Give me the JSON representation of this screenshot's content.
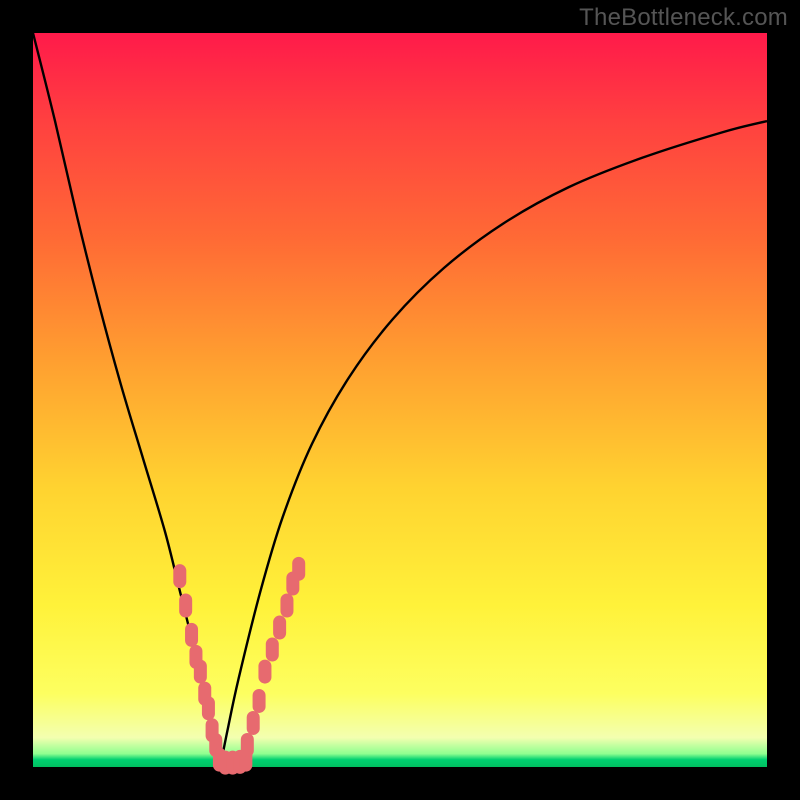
{
  "watermark": "TheBottleneck.com",
  "colors": {
    "page_bg": "#000000",
    "curve": "#000000",
    "marker_fill": "#e76a6f",
    "marker_stroke": "#c94a50",
    "gradient_stops": [
      "#ff1a4a",
      "#ff4040",
      "#ff6a35",
      "#ffa030",
      "#ffd330",
      "#fff23a",
      "#fdff60",
      "#f3ffb0",
      "#8fff90",
      "#00d070",
      "#00c060"
    ]
  },
  "chart_data": {
    "type": "line",
    "title": "",
    "xlabel": "",
    "ylabel": "",
    "xlim": [
      0,
      100
    ],
    "ylim": [
      0,
      100
    ],
    "grid": false,
    "notes": "Two black curves descending into a V; minimum near x≈25, y≈0. Background is a vertical red→yellow→green gradient. Pink rounded markers overlay the lower portion of both curves and along the trough.",
    "series": [
      {
        "name": "left-curve",
        "x": [
          0,
          3,
          6,
          9,
          12,
          15,
          18,
          20,
          22,
          23.5,
          24.5,
          25.5
        ],
        "values": [
          100,
          88,
          75,
          63,
          52,
          42,
          32,
          24,
          16,
          10,
          4,
          0
        ]
      },
      {
        "name": "right-curve",
        "x": [
          25.5,
          26.5,
          28,
          31,
          34,
          38,
          43,
          49,
          56,
          64,
          73,
          83,
          94,
          100
        ],
        "values": [
          0,
          5,
          12,
          24,
          34,
          44,
          53,
          61,
          68,
          74,
          79,
          83,
          86.5,
          88
        ]
      }
    ],
    "markers": {
      "name": "pink-markers",
      "shape": "rounded",
      "points": [
        {
          "x": 20.0,
          "y": 26
        },
        {
          "x": 20.8,
          "y": 22
        },
        {
          "x": 21.6,
          "y": 18
        },
        {
          "x": 22.2,
          "y": 15
        },
        {
          "x": 22.8,
          "y": 13
        },
        {
          "x": 23.4,
          "y": 10
        },
        {
          "x": 23.9,
          "y": 8
        },
        {
          "x": 24.4,
          "y": 5
        },
        {
          "x": 24.9,
          "y": 3
        },
        {
          "x": 25.4,
          "y": 1.0
        },
        {
          "x": 26.2,
          "y": 0.6
        },
        {
          "x": 27.2,
          "y": 0.6
        },
        {
          "x": 28.2,
          "y": 0.7
        },
        {
          "x": 29.0,
          "y": 1.0
        },
        {
          "x": 29.2,
          "y": 3
        },
        {
          "x": 30.0,
          "y": 6
        },
        {
          "x": 30.8,
          "y": 9
        },
        {
          "x": 31.6,
          "y": 13
        },
        {
          "x": 32.6,
          "y": 16
        },
        {
          "x": 33.6,
          "y": 19
        },
        {
          "x": 34.6,
          "y": 22
        },
        {
          "x": 35.4,
          "y": 25
        },
        {
          "x": 36.2,
          "y": 27
        }
      ]
    }
  }
}
